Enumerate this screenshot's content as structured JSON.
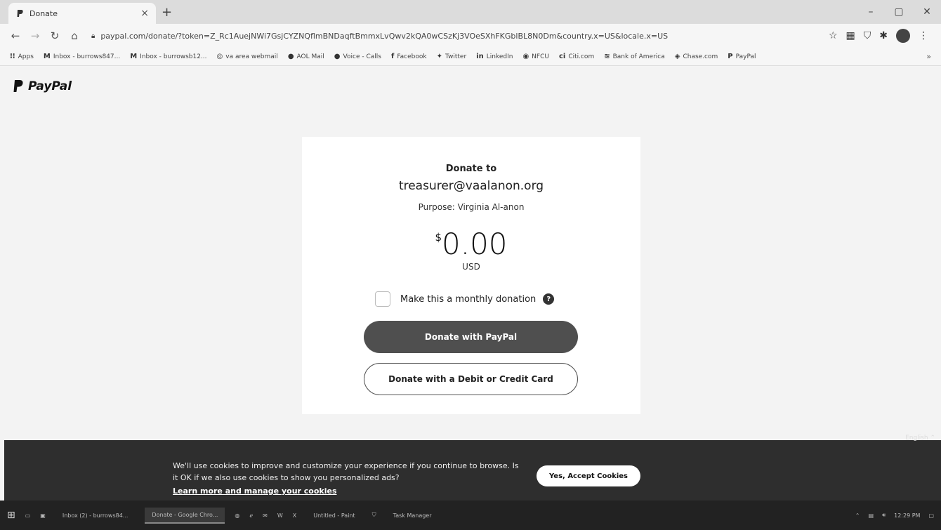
{
  "browser": {
    "tab": {
      "title": "Donate"
    },
    "window_controls": [
      "–",
      "▢",
      "✕"
    ],
    "url": "paypal.com/donate/?token=Z_Rc1AuejNWi7GsjCYZNQflmBNDaqftBmmxLvQwv2kQA0wCSzKj3VOeSXhFKGblBL8N0Dm&country.x=US&locale.x=US",
    "bookmarks": [
      {
        "icon": "apps-icon",
        "glyph": "⁝⁝",
        "label": "Apps"
      },
      {
        "icon": "gmail-icon",
        "glyph": "M",
        "label": "Inbox - burrows847..."
      },
      {
        "icon": "gmail-icon",
        "glyph": "M",
        "label": "Inbox - burrowsb12..."
      },
      {
        "icon": "webmail-icon",
        "glyph": "◎",
        "label": "va area webmail"
      },
      {
        "icon": "aol-icon",
        "glyph": "●",
        "label": "AOL Mail"
      },
      {
        "icon": "voice-icon",
        "glyph": "●",
        "label": "Voice - Calls"
      },
      {
        "icon": "facebook-icon",
        "glyph": "f",
        "label": "Facebook"
      },
      {
        "icon": "twitter-icon",
        "glyph": "✦",
        "label": "Twitter"
      },
      {
        "icon": "linkedin-icon",
        "glyph": "in",
        "label": "LinkedIn"
      },
      {
        "icon": "nfcu-icon",
        "glyph": "◉",
        "label": "NFCU"
      },
      {
        "icon": "citi-icon",
        "glyph": "ci",
        "label": "Citi.com"
      },
      {
        "icon": "boa-icon",
        "glyph": "≋",
        "label": "Bank of America"
      },
      {
        "icon": "chase-icon",
        "glyph": "◈",
        "label": "Chase.com"
      },
      {
        "icon": "paypal-icon",
        "glyph": "P",
        "label": "PayPal"
      }
    ],
    "bookmarks_more": "»"
  },
  "paypal": {
    "logo_text": "PayPal",
    "donate_to_label": "Donate to",
    "recipient": "treasurer@vaalanon.org",
    "purpose": "Purpose: Virginia Al-anon",
    "currency_symbol": "$",
    "amount": "0.00",
    "currency_code": "USD",
    "monthly_label": "Make this a monthly donation",
    "help_glyph": "?",
    "donate_paypal_button": "Donate with PayPal",
    "donate_card_button": "Donate with a Debit or Credit Card"
  },
  "cookie_banner": {
    "text": "We'll use cookies to improve and customize your experience if you continue to browse. Is it OK if we also use cookies to show you personalized ads?",
    "link": "Learn more and manage your cookies",
    "accept_button": "Yes, Accept Cookies",
    "language": "English ⌃"
  },
  "taskbar": {
    "apps": [
      {
        "label": "Inbox (2) - burrows84...",
        "active": false
      },
      {
        "label": "Donate - Google Chro...",
        "active": true
      },
      {
        "label": "Untitled - Paint",
        "active": false
      },
      {
        "label": "Task Manager",
        "active": false
      }
    ],
    "time": "12:29 PM"
  }
}
